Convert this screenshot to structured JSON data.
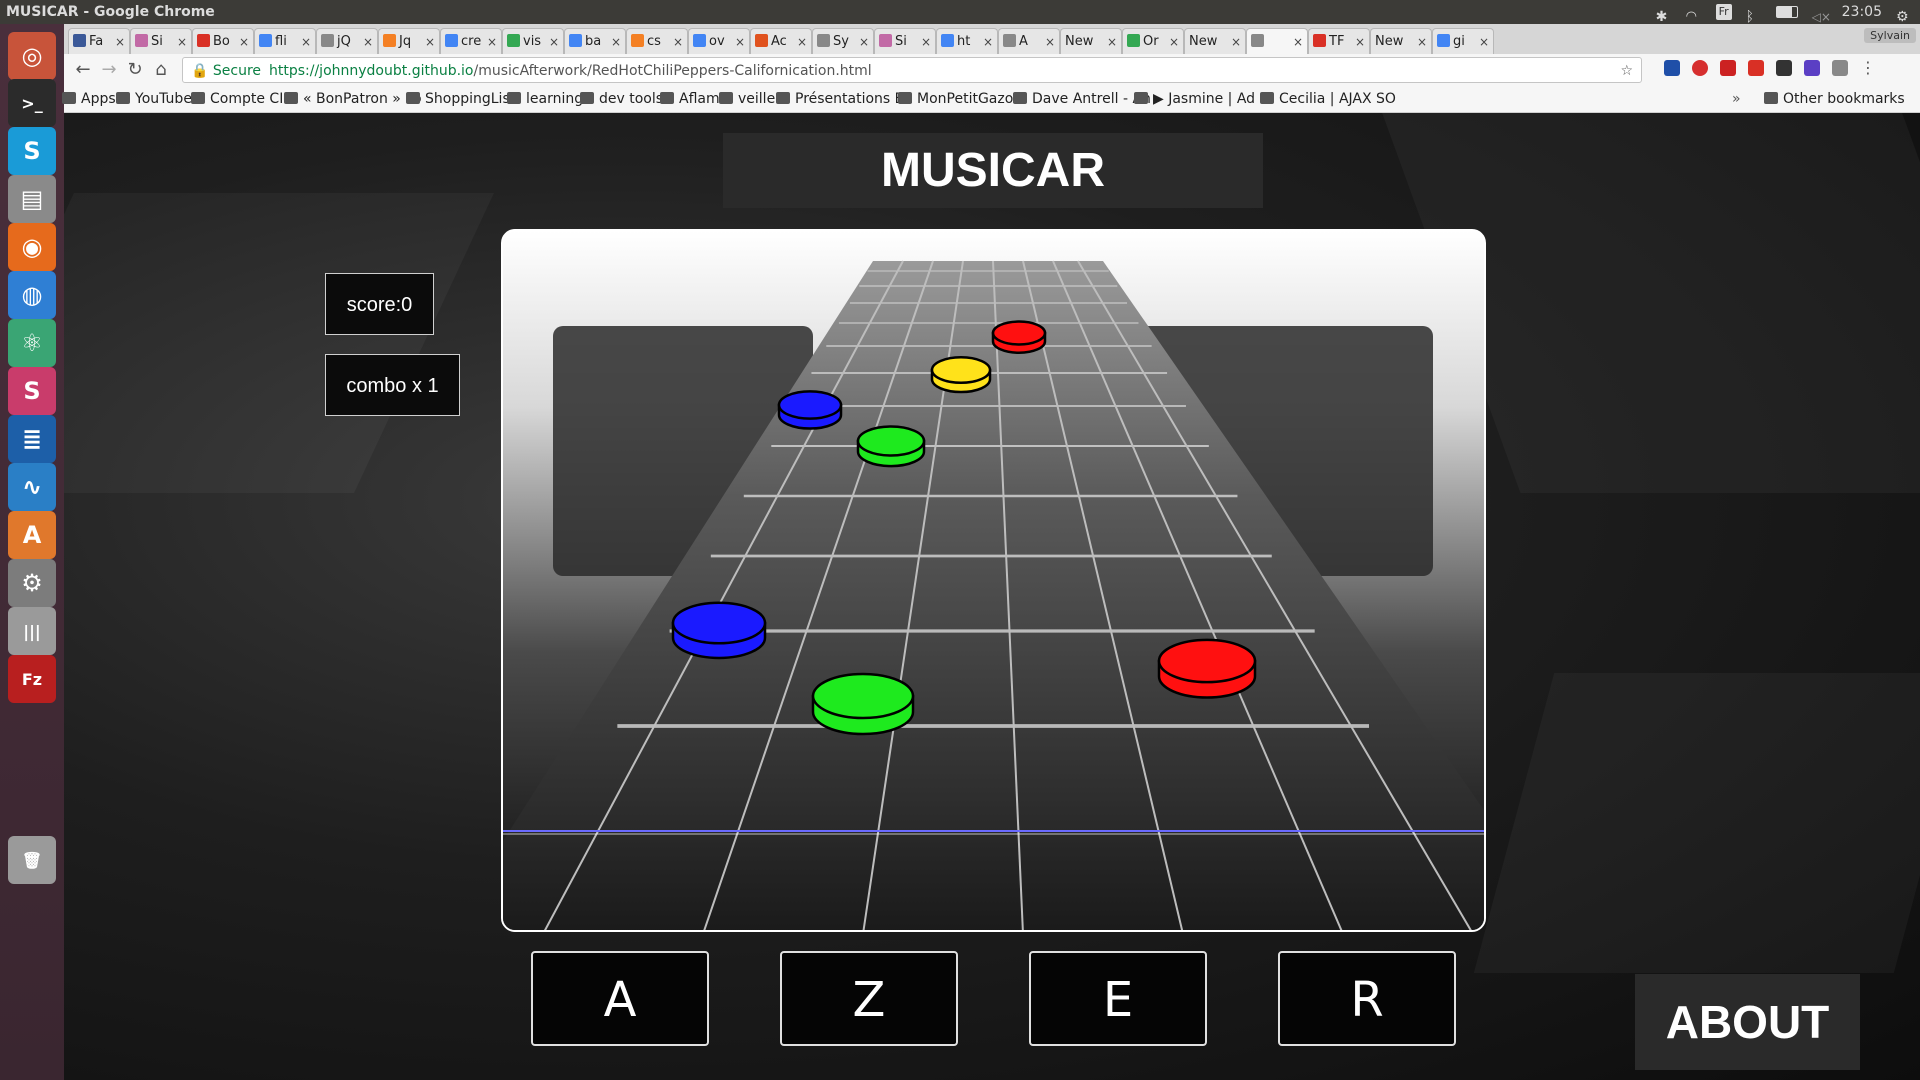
{
  "os": {
    "window_title": "MUSICAR - Google Chrome",
    "clock": "23:05",
    "keyboard_layout": "Fr",
    "user": "Sylvain"
  },
  "launcher": {
    "items": [
      {
        "name": "ubuntu-dash",
        "glyph": "◎",
        "color": "#c8543a"
      },
      {
        "name": "terminal",
        "glyph": ">_",
        "color": "#2b2b2b"
      },
      {
        "name": "skype",
        "glyph": "S",
        "color": "#1a9bd7"
      },
      {
        "name": "files",
        "glyph": "▤",
        "color": "#8a8a8a"
      },
      {
        "name": "firefox",
        "glyph": "◉",
        "color": "#e66a1c"
      },
      {
        "name": "chrome",
        "glyph": "◍",
        "color": "#2f7fd4"
      },
      {
        "name": "atom",
        "glyph": "⚛",
        "color": "#3aa574"
      },
      {
        "name": "slack",
        "glyph": "S",
        "color": "#c93c6b"
      },
      {
        "name": "libreoffice-writer",
        "glyph": "≣",
        "color": "#1d5fa8"
      },
      {
        "name": "system-monitor",
        "glyph": "∿",
        "color": "#2a7fc6"
      },
      {
        "name": "software-center",
        "glyph": "A",
        "color": "#e0782c"
      },
      {
        "name": "system-settings",
        "glyph": "⚙",
        "color": "#7c7c7c"
      },
      {
        "name": "mixer",
        "glyph": "|||",
        "color": "#9a9a9a"
      },
      {
        "name": "filezilla",
        "glyph": "Fz",
        "color": "#b81f1f"
      },
      {
        "name": "trash",
        "glyph": "🗑",
        "color": "#9a9a9a"
      }
    ]
  },
  "browser": {
    "tabs": [
      {
        "label": "Fa",
        "color": "#3b5998"
      },
      {
        "label": "Si",
        "color": "#c26aa6"
      },
      {
        "label": "Bo",
        "color": "#d93025"
      },
      {
        "label": "fli",
        "color": "#4285f4"
      },
      {
        "label": "jQ",
        "color": "#888888"
      },
      {
        "label": "Jq",
        "color": "#f48024"
      },
      {
        "label": "cre",
        "color": "#4285f4"
      },
      {
        "label": "vis",
        "color": "#34a853"
      },
      {
        "label": "ba",
        "color": "#4285f4"
      },
      {
        "label": "cs",
        "color": "#f48024"
      },
      {
        "label": "ov",
        "color": "#4285f4"
      },
      {
        "label": "Ac",
        "color": "#e0521e"
      },
      {
        "label": "Sy",
        "color": "#888888"
      },
      {
        "label": "Si",
        "color": "#c26aa6"
      },
      {
        "label": "ht",
        "color": "#4285f4"
      },
      {
        "label": "A",
        "color": "#888888"
      },
      {
        "label": "New",
        "color": ""
      },
      {
        "label": "Or",
        "color": "#34a853"
      },
      {
        "label": "New",
        "color": ""
      },
      {
        "label": "",
        "color": "#888888"
      },
      {
        "label": "TF",
        "color": "#d93025"
      },
      {
        "label": "New",
        "color": ""
      },
      {
        "label": "gi",
        "color": "#4285f4"
      }
    ],
    "secure_label": "Secure",
    "url_host": "https://johnnydoubt.github.io",
    "url_path": "/musicAfterwork/RedHotChiliPeppers-Californication.html",
    "bookmarks": [
      {
        "label": "Apps"
      },
      {
        "label": "YouTube"
      },
      {
        "label": "Compte CIC"
      },
      {
        "label": "« BonPatron » co"
      },
      {
        "label": "ShoppingList"
      },
      {
        "label": "learning"
      },
      {
        "label": "dev tools"
      },
      {
        "label": "Aflam"
      },
      {
        "label": "veille"
      },
      {
        "label": "Présentations Bu"
      },
      {
        "label": "MonPetitGazon"
      },
      {
        "label": "Dave Antrell - An"
      },
      {
        "label": "▶ Jasmine | Ad n"
      },
      {
        "label": "Cecilia | AJAX SO"
      }
    ],
    "overflow_chevron": "»",
    "other_bookmarks": "Other bookmarks"
  },
  "game": {
    "title": "MUSICAR",
    "score_label": "score:0",
    "combo_label": "combo x 1",
    "keys": [
      "A",
      "Z",
      "E",
      "R"
    ],
    "about_label": "ABOUT",
    "note_colors": {
      "A": "#1a1aff",
      "Z": "#1eea1e",
      "E": "#ffe21a",
      "R": "#ff1010"
    },
    "notes": [
      {
        "lane": "R",
        "color": "#ff1010"
      },
      {
        "lane": "E",
        "color": "#ffe21a"
      },
      {
        "lane": "A",
        "color": "#1a1aff"
      },
      {
        "lane": "Z",
        "color": "#1eea1e"
      },
      {
        "lane": "A",
        "color": "#1a1aff"
      },
      {
        "lane": "Z",
        "color": "#1eea1e"
      },
      {
        "lane": "R",
        "color": "#ff1010"
      }
    ]
  }
}
